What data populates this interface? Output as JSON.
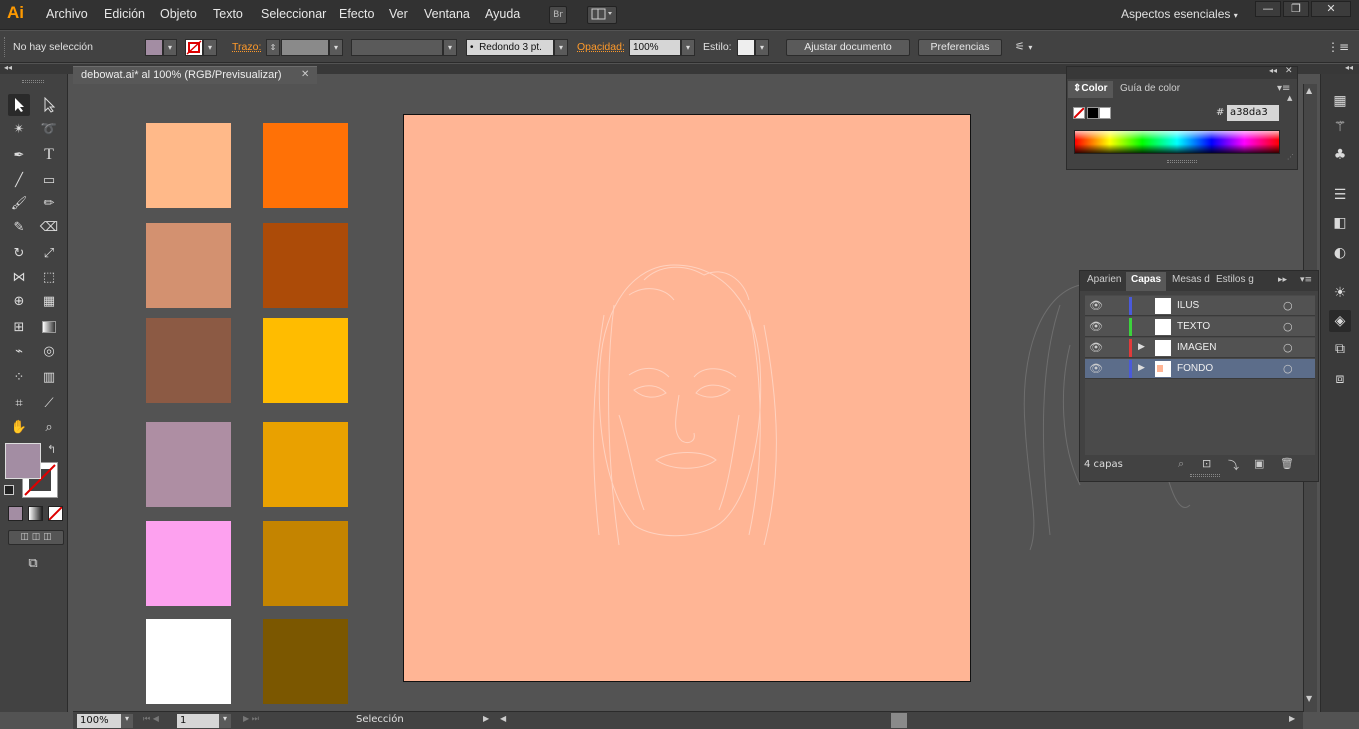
{
  "app": {
    "logo": "Ai"
  },
  "menu": [
    "Archivo",
    "Edición",
    "Objeto",
    "Texto",
    "Seleccionar",
    "Efecto",
    "Ver",
    "Ventana",
    "Ayuda"
  ],
  "menubar": {
    "bridge_label": "Br",
    "workspace": "Aspectos esenciales",
    "winbtns": [
      "—",
      "❐",
      "✕"
    ]
  },
  "control": {
    "selection_status": "No hay selección",
    "stroke_label": "Trazo:",
    "brush_label": "Redondo 3 pt.",
    "opacity_label": "Opacidad:",
    "opacity_value": "100%",
    "style_label": "Estilo:",
    "adjust_button": "Ajustar documento",
    "prefs_button": "Preferencias",
    "fill_color": "#a38da3"
  },
  "document": {
    "tab_title": "debowat.ai* al 100% (RGB/Previsualizar)",
    "artboard_color": "#ffb595"
  },
  "swatches": {
    "left": [
      "#ffb989",
      "#d39170",
      "#8c5a44",
      "#ae8ea3",
      "#fda1ef",
      "#ffffff"
    ],
    "right": [
      "#ff7106",
      "#ac4b08",
      "#ffbc00",
      "#e9a100",
      "#c48400",
      "#7b5700"
    ]
  },
  "color_panel": {
    "tabs": [
      "Color",
      "Guía de color"
    ],
    "hex_label": "#",
    "hex_value": "a38da3"
  },
  "layers_panel": {
    "tabs": [
      "Aparien",
      "Capas",
      "Mesas d",
      "Estilos g"
    ],
    "layers": [
      {
        "name": "ILUS",
        "color": "#4a5adb"
      },
      {
        "name": "TEXTO",
        "color": "#3cd23c"
      },
      {
        "name": "IMAGEN",
        "color": "#e23a3a"
      },
      {
        "name": "FONDO",
        "color": "#4a5adb"
      }
    ],
    "count_label": "4 capas"
  },
  "status": {
    "zoom": "100%",
    "artboard_num": "1",
    "tool_name": "Selección"
  },
  "colors": {
    "accent": "#ff9a2a",
    "toolbar": "#424242",
    "canvas": "#535353"
  }
}
